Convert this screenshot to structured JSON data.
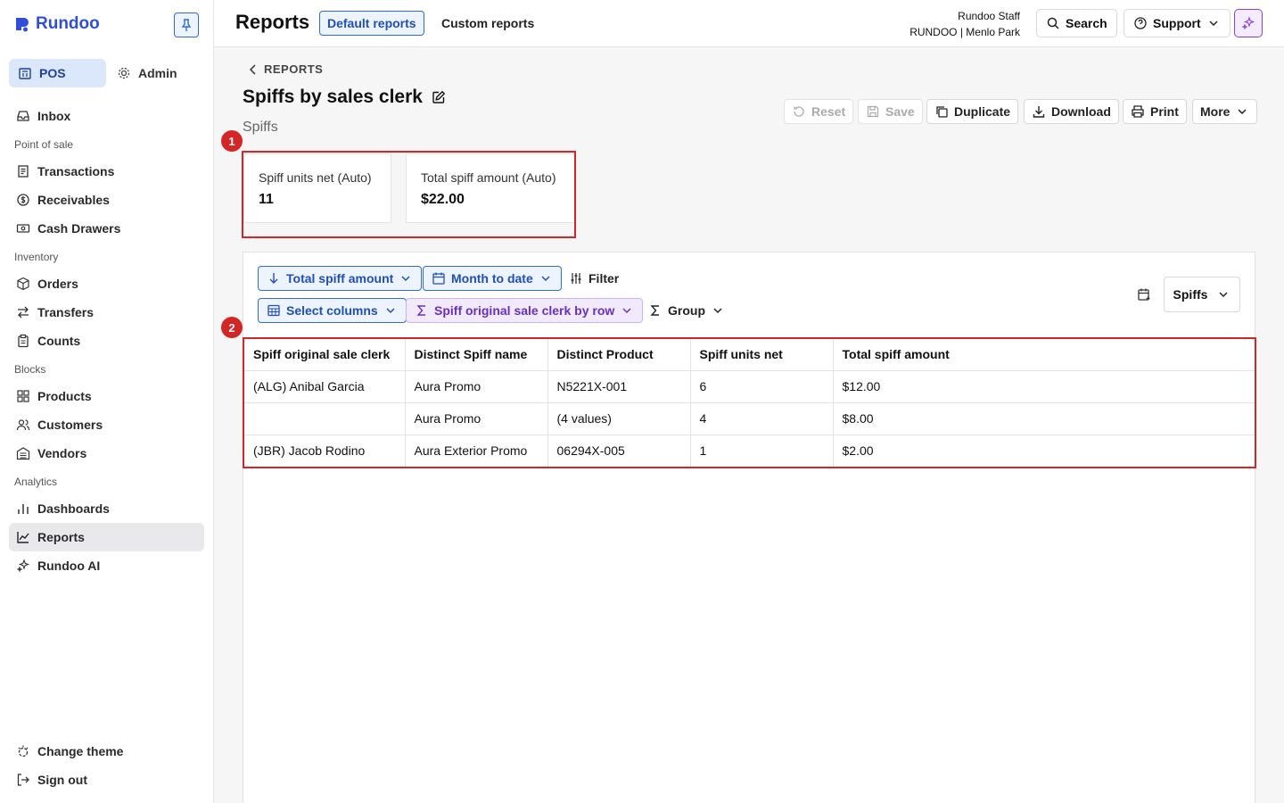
{
  "app": {
    "logo_text": "Rundoo"
  },
  "sidebar": {
    "modes": [
      {
        "label": "POS"
      },
      {
        "label": "Admin"
      }
    ],
    "inbox": "Inbox",
    "sections": {
      "point_of_sale": "Point of sale",
      "inventory": "Inventory",
      "blocks": "Blocks",
      "analytics": "Analytics"
    },
    "items": {
      "transactions": "Transactions",
      "receivables": "Receivables",
      "cash_drawers": "Cash Drawers",
      "orders": "Orders",
      "transfers": "Transfers",
      "counts": "Counts",
      "products": "Products",
      "customers": "Customers",
      "vendors": "Vendors",
      "dashboards": "Dashboards",
      "reports": "Reports",
      "rundoo_ai": "Rundoo AI"
    },
    "bottom": {
      "change_theme": "Change theme",
      "sign_out": "Sign out"
    }
  },
  "header": {
    "title": "Reports",
    "tabs": [
      {
        "label": "Default reports"
      },
      {
        "label": "Custom reports"
      }
    ],
    "user": {
      "name": "Rundoo Staff",
      "store": "RUNDOO | Menlo Park"
    },
    "search": "Search",
    "support": "Support"
  },
  "report": {
    "breadcrumb": "REPORTS",
    "title": "Spiffs by sales clerk",
    "subtitle": "Spiffs",
    "actions": {
      "reset": "Reset",
      "save": "Save",
      "duplicate": "Duplicate",
      "download": "Download",
      "print": "Print",
      "more": "More"
    },
    "metrics": [
      {
        "label": "Spiff units net (Auto)",
        "value": "11"
      },
      {
        "label": "Total spiff amount (Auto)",
        "value": "$22.00"
      }
    ],
    "controls": {
      "sort": "Total spiff amount",
      "date_range": "Month to date",
      "filter": "Filter",
      "columns": "Select columns",
      "group_by": "Spiff original sale clerk by row",
      "group": "Group",
      "view_select": "Spiffs"
    },
    "table": {
      "headers": [
        "Spiff original sale clerk",
        "Distinct Spiff name",
        "Distinct Product",
        "Spiff units net",
        "Total spiff amount"
      ],
      "rows": [
        [
          "(ALG) Anibal Garcia",
          "Aura Promo",
          "N5221X-001",
          "6",
          "$12.00"
        ],
        [
          "",
          "Aura Promo",
          "(4 values)",
          "4",
          "$8.00"
        ],
        [
          "(JBR) Jacob Rodino",
          "Aura Exterior Promo",
          "06294X-005",
          "1",
          "$2.00"
        ]
      ]
    },
    "annotations": [
      "1",
      "2"
    ]
  },
  "colors": {
    "accent": "#2f6bdc",
    "brand": "#2f4fd8",
    "annotation": "#d32626",
    "ai": "#8b3fd9"
  }
}
